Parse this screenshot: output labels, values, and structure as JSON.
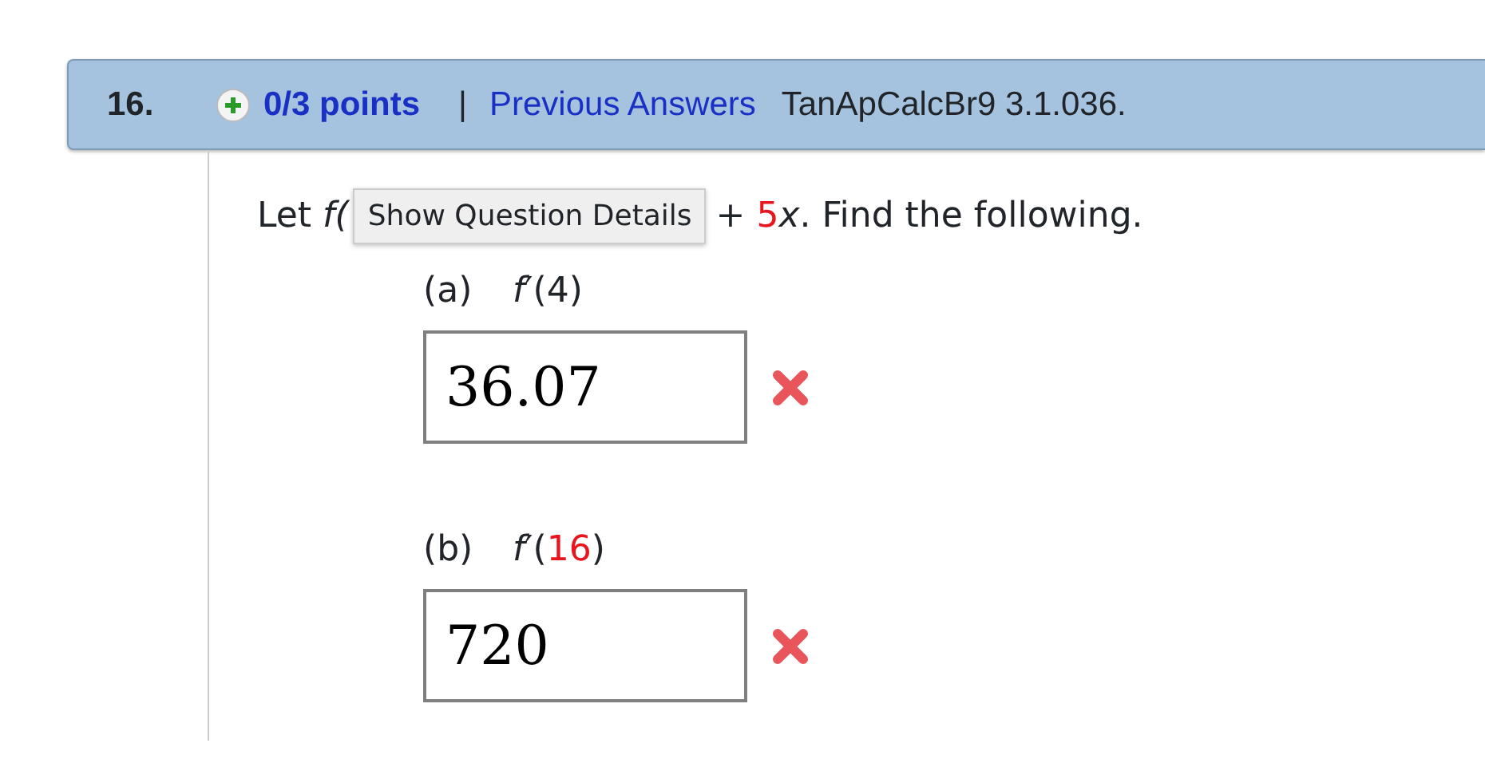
{
  "header": {
    "number": "16.",
    "points": "0/3 points",
    "separator": "|",
    "previous_answers": "Previous Answers",
    "reference": "TanApCalcBr9 3.1.036."
  },
  "question": {
    "before": [
      {
        "text": "Let ",
        "kind": "plain"
      },
      {
        "text": "f(",
        "kind": "italic"
      }
    ],
    "tooltip": "Show Question Details",
    "after": [
      {
        "text": "+ ",
        "kind": "plain"
      },
      {
        "text": "5",
        "kind": "red"
      },
      {
        "text": "x",
        "kind": "italic"
      },
      {
        "text": ". Find the following.",
        "kind": "plain"
      }
    ]
  },
  "parts": [
    {
      "label": "(a)",
      "expression": [
        {
          "text": "f",
          "kind": "italic"
        },
        {
          "text": "′(",
          "kind": "plain"
        },
        {
          "text": "4",
          "kind": "plain"
        },
        {
          "text": ")",
          "kind": "plain"
        }
      ],
      "answer": "36.07",
      "correct": false
    },
    {
      "label": "(b)",
      "expression": [
        {
          "text": "f",
          "kind": "italic"
        },
        {
          "text": "′(",
          "kind": "plain"
        },
        {
          "text": "16",
          "kind": "red"
        },
        {
          "text": ")",
          "kind": "plain"
        }
      ],
      "answer": "720",
      "correct": false
    }
  ]
}
